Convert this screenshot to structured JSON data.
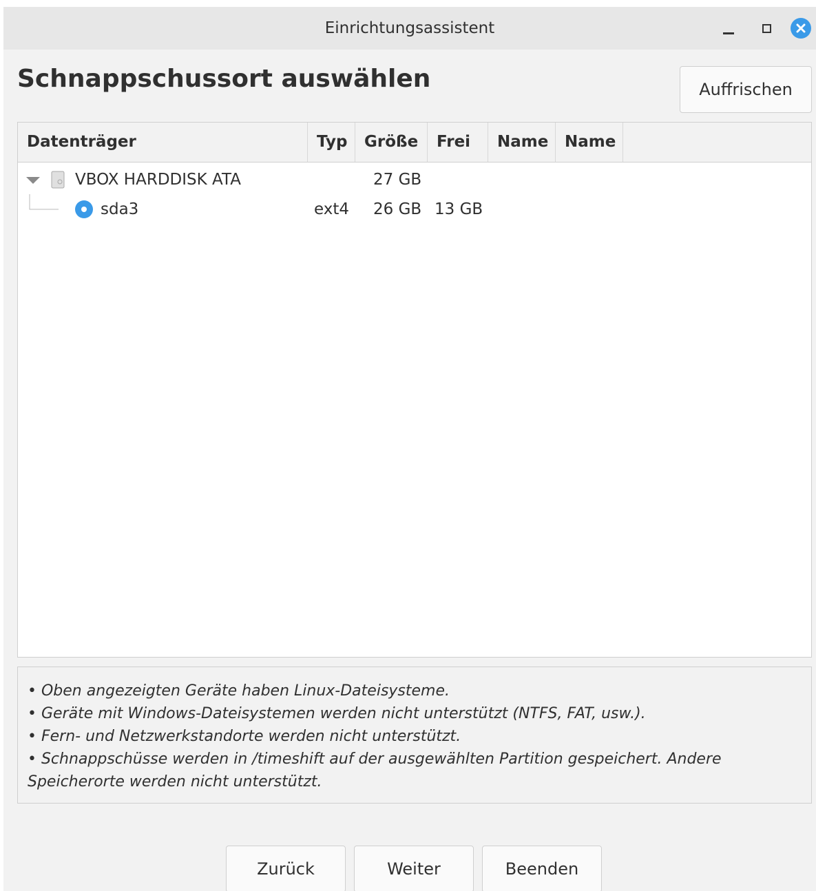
{
  "window": {
    "title": "Einrichtungsassistent",
    "accent_color": "#3a9ae8"
  },
  "page_title": "Schnappschussort auswählen",
  "refresh_button": "Auffrischen",
  "columns": [
    "Datenträger",
    "Typ",
    "Größe",
    "Frei",
    "Name",
    "Name"
  ],
  "devices": [
    {
      "label": "VBOX HARDDISK ATA",
      "type": "",
      "size": "27 GB",
      "free": "",
      "icon": "harddisk-icon",
      "expanded": true
    },
    {
      "label": "sda3",
      "type": "ext4",
      "size": "26 GB",
      "free": "13 GB",
      "icon": "radio-selected-icon",
      "selected": true
    }
  ],
  "notes": [
    "• Oben angezeigten Geräte haben Linux-Dateisysteme.",
    "• Geräte mit Windows-Dateisystemen werden nicht unterstützt (NTFS, FAT, usw.).",
    "• Fern- und Netzwerkstandorte werden nicht unterstützt.",
    "• Schnappschüsse werden in /timeshift auf der ausgewählten Partition gespeichert. Andere Speicherorte werden nicht unterstützt."
  ],
  "buttons": {
    "back": "Zurück",
    "next": "Weiter",
    "finish": "Beenden"
  }
}
